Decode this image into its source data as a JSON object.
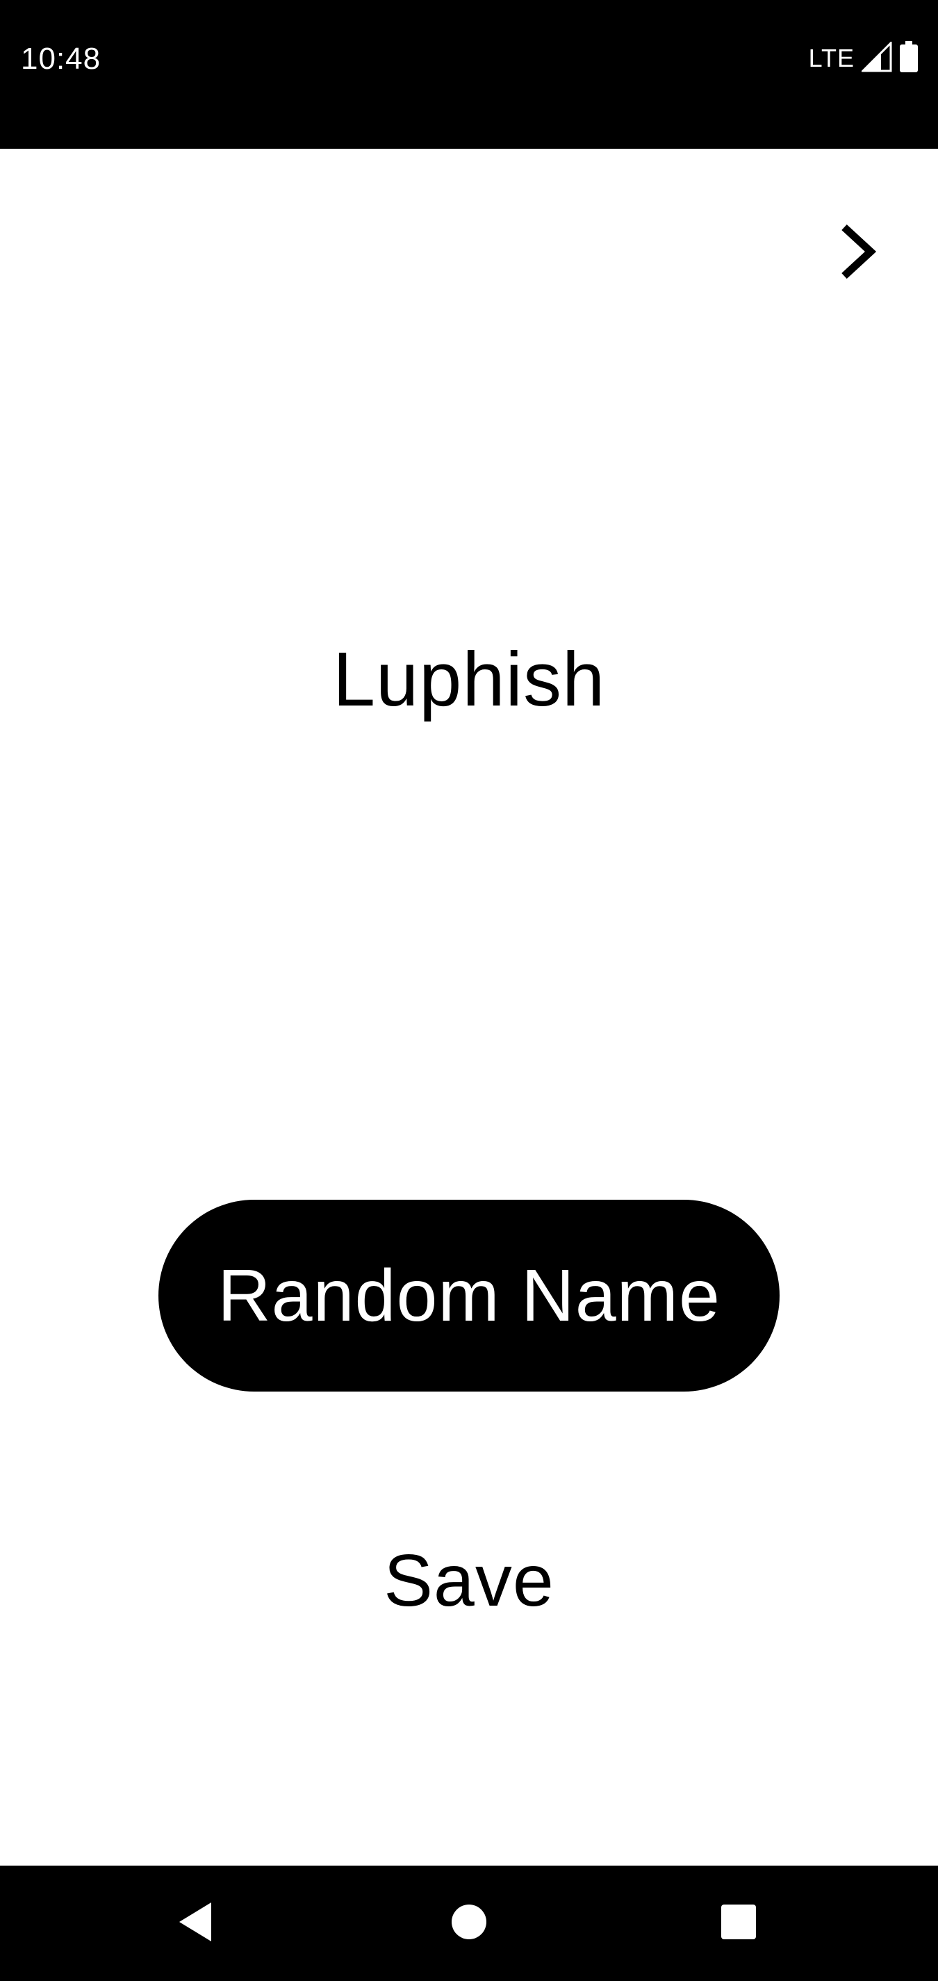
{
  "status_bar": {
    "time": "10:48",
    "network": "LTE",
    "icons": [
      "signal-icon",
      "battery-icon"
    ]
  },
  "main": {
    "next_icon": "chevron-right-icon",
    "generated_name": "Luphish",
    "random_button_label": "Random Name",
    "save_label": "Save"
  },
  "nav_bar": {
    "icons": [
      "back-icon",
      "home-icon",
      "recents-icon"
    ]
  },
  "colors": {
    "background": "#ffffff",
    "bars": "#000000",
    "button": "#000000",
    "button_text": "#ffffff"
  }
}
